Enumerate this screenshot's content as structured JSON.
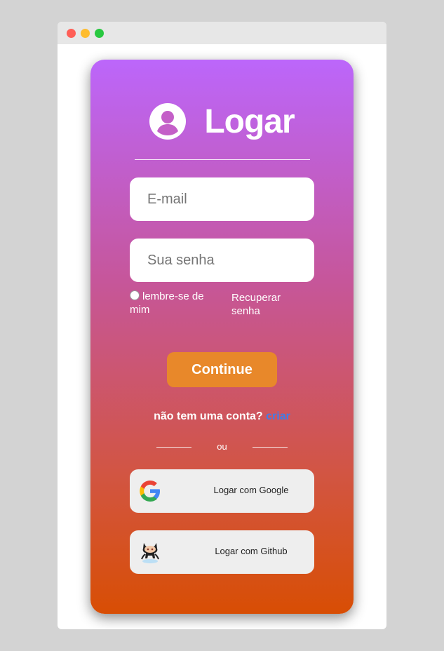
{
  "window": {
    "controls": [
      "close",
      "minimize",
      "maximize"
    ]
  },
  "colors": {
    "gradient_top": "#bc66fb",
    "gradient_bottom": "#d84e04",
    "continue_button": "#e8882a",
    "link": "#3f7de8"
  },
  "login": {
    "title": "Logar",
    "title_icon": "user-circle-icon",
    "email_placeholder": "E-mail",
    "password_placeholder": "Sua senha",
    "remember_label": "lembre-se de mim",
    "recover_label": "Recuperar senha",
    "continue_label": "Continue",
    "signup_text": "não tem uma conta?",
    "signup_link": "criar",
    "or_text": "ou",
    "google_label": "Logar com Google",
    "google_icon": "google-icon",
    "github_label": "Logar com Github",
    "github_icon": "github-octocat-icon"
  }
}
